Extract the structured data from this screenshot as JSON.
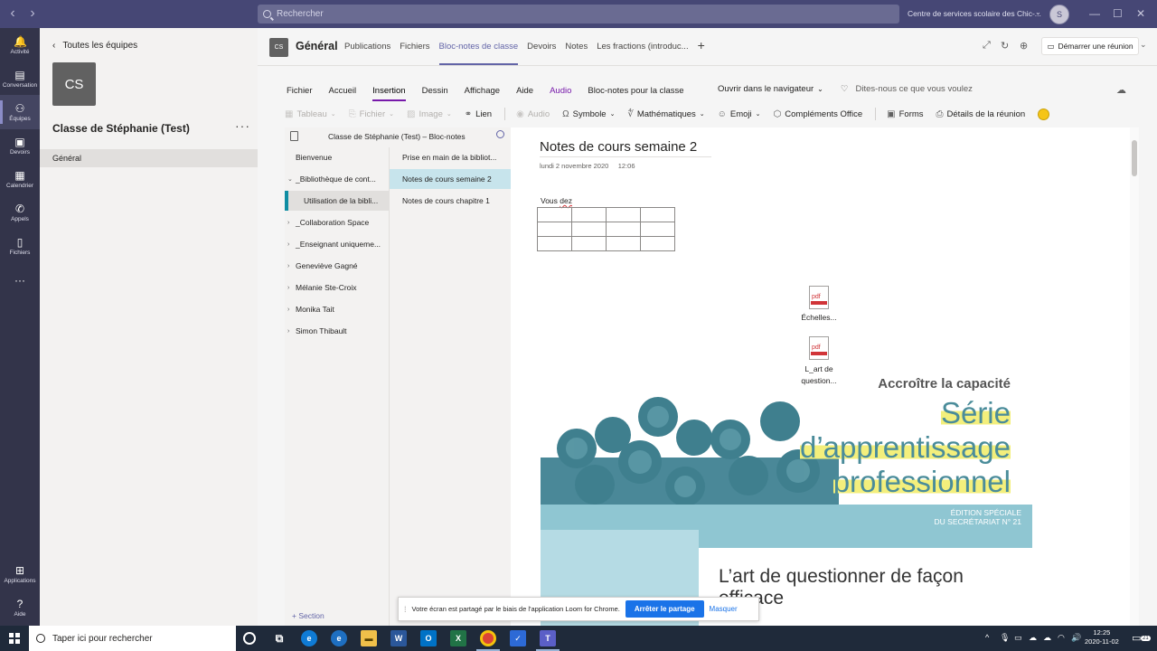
{
  "titlebar": {
    "search_placeholder": "Rechercher",
    "org_name": "Centre de services scolaire des Chic-...",
    "avatar_initials": "S"
  },
  "rail": [
    {
      "label": "Activité",
      "icon": "bell-icon",
      "glyph": "🔔"
    },
    {
      "label": "Conversation",
      "icon": "chat-icon",
      "glyph": "▤"
    },
    {
      "label": "Équipes",
      "icon": "teams-icon",
      "glyph": "⚇"
    },
    {
      "label": "Devoirs",
      "icon": "assignments-icon",
      "glyph": "▣"
    },
    {
      "label": "Calendrier",
      "icon": "calendar-icon",
      "glyph": "▦"
    },
    {
      "label": "Appels",
      "icon": "phone-icon",
      "glyph": "✆"
    },
    {
      "label": "Fichiers",
      "icon": "files-icon",
      "glyph": "▯"
    },
    {
      "label": "",
      "icon": "more-icon",
      "glyph": "···"
    },
    {
      "label": "Applications",
      "icon": "apps-icon",
      "glyph": "⊞"
    },
    {
      "label": "Aide",
      "icon": "help-icon",
      "glyph": "?"
    }
  ],
  "team_panel": {
    "back_label": "Toutes les équipes",
    "tile_initials": "CS",
    "team_name": "Classe de Stéphanie (Test)",
    "more": "···",
    "channel": "Général"
  },
  "channel_header": {
    "tile_initials": "CS",
    "title": "Général",
    "tabs": [
      "Publications",
      "Fichiers",
      "Bloc-notes de classe",
      "Devoirs",
      "Notes",
      "Les fractions (introduc..."
    ],
    "active_tab": "Bloc-notes de classe",
    "meet_button": "Démarrer une réunion"
  },
  "ribbon": {
    "menu": [
      "Fichier",
      "Accueil",
      "Insertion",
      "Dessin",
      "Affichage",
      "Aide",
      "Audio",
      "Bloc-notes pour la classe"
    ],
    "active_menu": "Insertion",
    "open_browser": "Ouvrir dans le navigateur",
    "tell_me": "Dites-nous ce que vous voulez",
    "commands": [
      {
        "label": "Tableau",
        "disabled": true,
        "icon": "table-icon",
        "glyph": "▦",
        "chevron": true
      },
      {
        "label": "Fichier",
        "disabled": true,
        "icon": "attach-icon",
        "glyph": "⎘",
        "chevron": true
      },
      {
        "label": "Image",
        "disabled": true,
        "icon": "image-icon",
        "glyph": "▨",
        "chevron": true
      },
      {
        "label": "Lien",
        "disabled": false,
        "icon": "link-icon",
        "glyph": "⚭",
        "chevron": false
      },
      {
        "label": "Audio",
        "disabled": true,
        "icon": "record-icon",
        "glyph": "◉",
        "chevron": false
      },
      {
        "label": "Symbole",
        "disabled": false,
        "icon": "omega-icon",
        "glyph": "Ω",
        "chevron": true
      },
      {
        "label": "Mathématiques",
        "disabled": false,
        "icon": "math-icon",
        "glyph": "∜",
        "chevron": true
      },
      {
        "label": "Emoji",
        "disabled": false,
        "icon": "emoji-icon",
        "glyph": "☺",
        "chevron": true
      },
      {
        "label": "Compléments Office",
        "disabled": false,
        "icon": "addins-icon",
        "glyph": "⬡",
        "chevron": false
      },
      {
        "label": "Forms",
        "disabled": false,
        "icon": "forms-icon",
        "glyph": "▣",
        "chevron": false
      },
      {
        "label": "Détails de la réunion",
        "disabled": false,
        "icon": "meeting-details-icon",
        "glyph": "⎙",
        "chevron": false
      }
    ]
  },
  "notebook": {
    "title": "Classe de Stéphanie (Test) – Bloc-notes",
    "sections": [
      {
        "label": "Bienvenue",
        "expander": "",
        "color": "#6b2fa0"
      },
      {
        "label": "_Bibliothèque de cont...",
        "expander": "⌄",
        "color": "#3b3a39"
      },
      {
        "label": "Utilisation de la bibli...",
        "expander": "",
        "color": "",
        "sub": true
      },
      {
        "label": "_Collaboration Space",
        "expander": "›",
        "color": "#3b3a39"
      },
      {
        "label": "_Enseignant uniqueme...",
        "expander": "›",
        "color": "#3b3a39"
      },
      {
        "label": "Geneviève Gagné",
        "expander": "›",
        "color": "#3b3a39"
      },
      {
        "label": "Mélanie Ste-Croix",
        "expander": "›",
        "color": "#3b3a39"
      },
      {
        "label": "Monika Tait",
        "expander": "›",
        "color": "#3b3a39"
      },
      {
        "label": "Simon Thibault",
        "expander": "›",
        "color": "#3b3a39"
      }
    ],
    "pages": [
      {
        "label": "Prise en main de la bibliot...",
        "selected": false
      },
      {
        "label": "Notes de cours semaine 2",
        "selected": true
      },
      {
        "label": "Notes de cours chapitre 1",
        "selected": false
      }
    ],
    "add_section": "+ Section"
  },
  "page": {
    "title": "Notes de cours semaine 2",
    "date": "lundi 2 novembre 2020",
    "time": "12:06",
    "text_prefix": "Vous ",
    "text_misspelled": "dez",
    "files": [
      {
        "icon_label": "pdf",
        "name": "Échelles..."
      },
      {
        "icon_label": "pdf",
        "name": "L_art de question..."
      }
    ],
    "poster": {
      "kicker": "Accroître la capacité",
      "serie_line1": "Série",
      "serie_line2": "d’apprentissage",
      "serie_line3": "professionnel",
      "edition_line1": "ÉDITION SPÉCIALE",
      "edition_line2": "DU SECRÉTARIAT N° 21",
      "headline": "L’art de questionner de façon efficace"
    }
  },
  "sharebar": {
    "message": "Votre écran est partagé par le biais de l'application Loom for Chrome.",
    "stop_button": "Arrêter le partage",
    "hide_link": "Masquer"
  },
  "taskbar": {
    "search_placeholder": "Taper ici pour rechercher",
    "time": "12:25",
    "date": "2020-11-02",
    "notifications": "21"
  }
}
